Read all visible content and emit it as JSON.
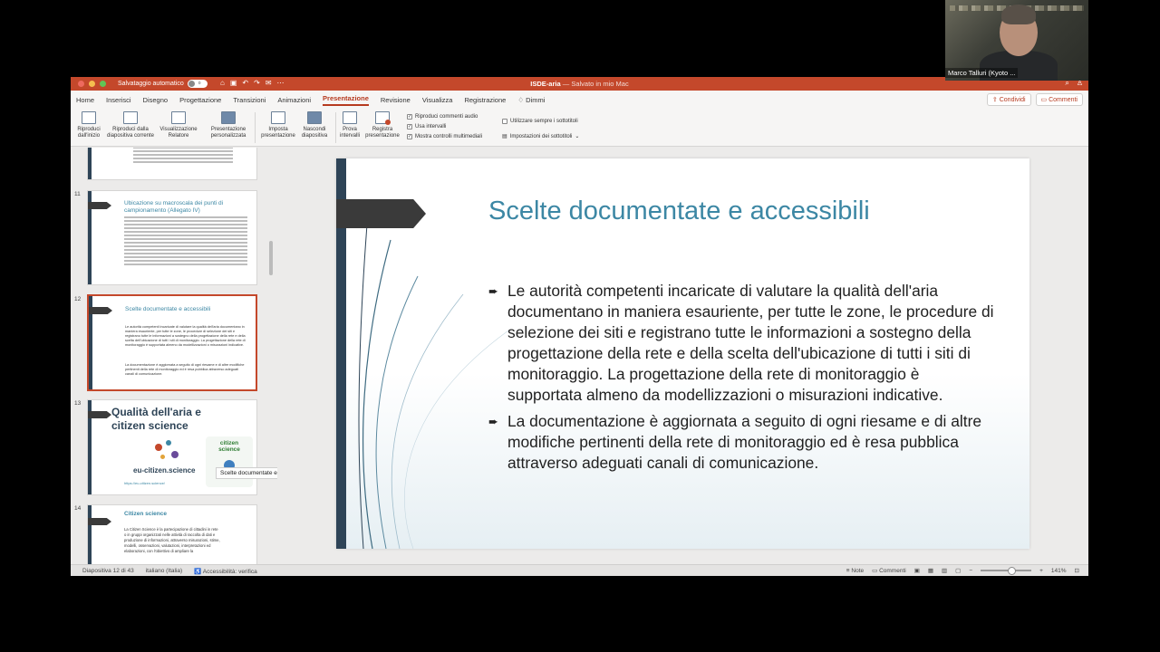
{
  "window": {
    "autosave_label": "Salvataggio automatico",
    "autosave_state": "o",
    "doc_name": "ISDE-aria",
    "doc_status": "— Salvato in mio Mac"
  },
  "tabs": [
    "Home",
    "Inserisci",
    "Disegno",
    "Progettazione",
    "Transizioni",
    "Animazioni",
    "Presentazione",
    "Revisione",
    "Visualizza",
    "Registrazione",
    "Dimmi"
  ],
  "active_tab": "Presentazione",
  "share": {
    "share_label": "Condividi",
    "comments_label": "Commenti"
  },
  "ribbon": {
    "play_start": [
      "Riproduci",
      "dall'inizio"
    ],
    "play_current": [
      "Riproduci dalla",
      "diapositiva corrente"
    ],
    "presenter": [
      "Visualizzazione",
      "Relatore"
    ],
    "custom": [
      "Presentazione",
      "personalizzata"
    ],
    "setup": [
      "Imposta",
      "presentazione"
    ],
    "hide": [
      "Nascondi",
      "diapositiva"
    ],
    "rehearse": [
      "Prova",
      "intervalli"
    ],
    "record": [
      "Registra",
      "presentazione"
    ],
    "check_audio": "Riproduci commenti audio",
    "check_timings": "Usa intervalli",
    "check_controls": "Mostra controlli multimediali",
    "subtitles_always": "Utilizzare sempre i sottotitoli",
    "subtitle_settings": "Impostazioni dei sottotitoli"
  },
  "thumbnails": {
    "n11": "11",
    "t11_title": "Ubicazione su macroscala dei punti di campionamento (Allegato IV)",
    "n12": "12",
    "t12_title": "Scelte documentate e accessibili",
    "t12_b1": "Le autorità competenti incaricate di valutare la qualità dell'aria documentano in maniera esauriente, per tutte le zone, le procedure di selezione dei siti e registrano tutte le informazioni a sostegno della progettazione della rete e della scelta dell'ubicazione di tutti i siti di monitoraggio. La progettazione della rete di monitoraggio è supportata almeno da modellizzazioni o misurazioni indicative.",
    "t12_b2": "La documentazione è aggiornata a seguito di ogni riesame e di altre modifiche pertinenti della rete di monitoraggio ed è resa pubblica attraverso adeguati canali di comunicazione.",
    "n13": "13",
    "t13_title": "Qualità dell'aria e citizen science",
    "t13_logo": "eu-citizen.science",
    "t13_logo2": "citizen science",
    "t13_link": "https://eu-citizen.science/",
    "n14": "14",
    "t14_title": "Citizen science",
    "t14_text": "La Citizen Science è la partecipazione di cittadini in rete o in gruppi organizzati nelle attività di raccolta di dati e produzione di informazioni, attraverso misurazioni, stime, modelli, osservazioni, valutazioni, interpretazioni ed elaborazioni, con l'obiettivo di ampliare la"
  },
  "tooltip": "Scelte documentate e accessibili",
  "slide": {
    "title": "Scelte documentate e accessibili",
    "bullet1": "Le autorità competenti incaricate di valutare la qualità dell'aria documentano in maniera esauriente, per tutte le zone, le procedure di selezione dei siti e registrano tutte le informazioni a sostegno della progettazione della rete e della scelta dell'ubicazione di tutti i siti di monitoraggio. La progettazione della rete di monitoraggio è supportata almeno da modellizzazioni o misurazioni indicative.",
    "bullet2": "La documentazione è aggiornata a seguito di ogni riesame e di altre modifiche pertinenti della rete di monitoraggio ed è resa pubblica attraverso adeguati canali di comunicazione."
  },
  "status": {
    "slide_pos": "Diapositiva 12 di 43",
    "language": "italiano (Italia)",
    "accessibility": "Accessibilità: verifica",
    "notes": "Note",
    "comments": "Commenti",
    "zoom": "141%"
  },
  "webcam": {
    "name": "Marco Talluri (Kyoto ..."
  },
  "colors": {
    "accent": "#c4482b",
    "title_blue": "#3c87a4",
    "slide_bar": "#2e4457"
  }
}
